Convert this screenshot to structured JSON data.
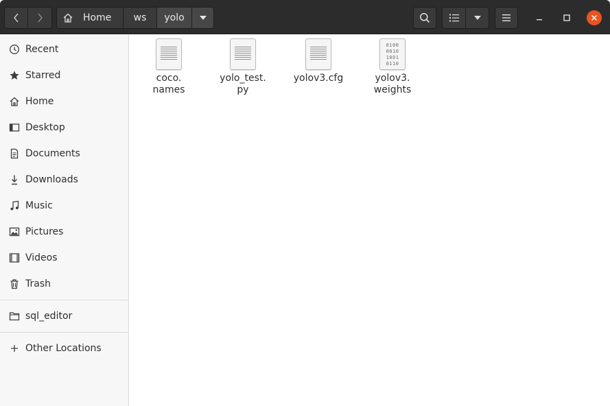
{
  "toolbar": {
    "back_icon": "chevron-left-icon",
    "forward_icon": "chevron-right-icon",
    "breadcrumbs": [
      {
        "label": "Home",
        "icon": "home-icon"
      },
      {
        "label": "ws"
      },
      {
        "label": "yolo"
      }
    ],
    "search_icon": "search-icon",
    "view_icon": "list-view-icon",
    "menu_icon": "hamburger-menu-icon"
  },
  "window_controls": {
    "minimize_icon": "minimize-icon",
    "maximize_icon": "maximize-icon",
    "close_icon": "close-icon",
    "close_color": "#e95420"
  },
  "sidebar": {
    "items": [
      {
        "label": "Recent",
        "icon": "clock-icon"
      },
      {
        "label": "Starred",
        "icon": "star-icon"
      },
      {
        "label": "Home",
        "icon": "home-icon"
      },
      {
        "label": "Desktop",
        "icon": "desktop-icon"
      },
      {
        "label": "Documents",
        "icon": "document-icon"
      },
      {
        "label": "Downloads",
        "icon": "download-icon"
      },
      {
        "label": "Music",
        "icon": "music-icon"
      },
      {
        "label": "Pictures",
        "icon": "picture-icon"
      },
      {
        "label": "Videos",
        "icon": "video-icon"
      },
      {
        "label": "Trash",
        "icon": "trash-icon"
      }
    ],
    "bookmarks": [
      {
        "label": "sql_editor",
        "icon": "folder-icon"
      }
    ],
    "other": {
      "label": "Other Locations",
      "icon": "plus-icon"
    }
  },
  "files": [
    {
      "name": "coco.\nnames",
      "type": "text"
    },
    {
      "name": "yolo_test.\npy",
      "type": "text"
    },
    {
      "name": "yolov3.cfg",
      "type": "text"
    },
    {
      "name": "yolov3.\nweights",
      "type": "binary",
      "binary_text": [
        "0100",
        "0010",
        "1001",
        "0110"
      ]
    }
  ]
}
